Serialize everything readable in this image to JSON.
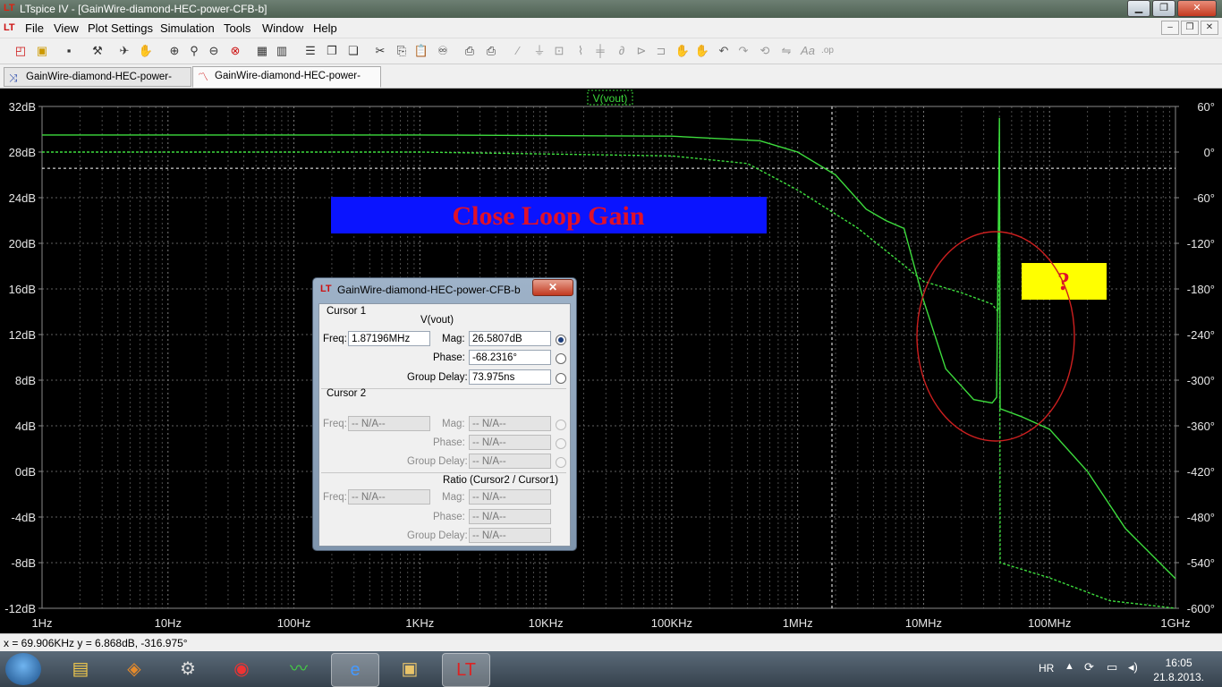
{
  "window": {
    "title": "LTspice IV - [GainWire-diamond-HEC-power-CFB-b]",
    "buttons": {
      "minimize": "▁",
      "maximize": "❐",
      "close": "✕"
    },
    "mdi_buttons": {
      "minimize": "–",
      "restore": "❐",
      "close": "✕"
    }
  },
  "menu": [
    "File",
    "View",
    "Plot Settings",
    "Simulation",
    "Tools",
    "Window",
    "Help"
  ],
  "tabs": [
    {
      "label": "GainWire-diamond-HEC-power-CFB-b",
      "icon": "schematic-icon",
      "active": false
    },
    {
      "label": "GainWire-diamond-HEC-power-CFB-b",
      "icon": "waveform-icon",
      "active": true
    }
  ],
  "plot": {
    "trace_label": "V(vout)",
    "annotation": "Close Loop Gain",
    "question": "?",
    "colors": {
      "trace": "#3ddc3d",
      "grid": "#8a8a8a",
      "annotation_bg": "#0a14ff",
      "annotation_text": "#e0102a",
      "question_bg": "#ffff00",
      "circle": "#cc1f1f",
      "axis_text": "#e6e6e6"
    },
    "x_labels": [
      "1Hz",
      "10Hz",
      "100Hz",
      "1KHz",
      "10KHz",
      "100KHz",
      "1MHz",
      "10MHz",
      "100MHz",
      "1GHz"
    ],
    "y_left_labels": [
      "32dB",
      "28dB",
      "24dB",
      "20dB",
      "16dB",
      "12dB",
      "8dB",
      "4dB",
      "0dB",
      "-4dB",
      "-8dB",
      "-12dB"
    ],
    "y_right_labels": [
      "60°",
      "0°",
      "-60°",
      "-120°",
      "-180°",
      "-240°",
      "-300°",
      "-360°",
      "-420°",
      "-480°",
      "-540°",
      "-600°"
    ]
  },
  "chart_data": {
    "type": "line",
    "title": "",
    "xlabel": "",
    "ylabel": "",
    "x_scale": "log",
    "xlim": [
      "1Hz",
      "1GHz"
    ],
    "ylim_left_db": [
      -12,
      32
    ],
    "ylim_right_deg": [
      -600,
      60
    ],
    "series": [
      {
        "name": "V(vout)",
        "axis": "magnitude dB",
        "points": [
          [
            1,
            29.5
          ],
          [
            1000,
            29.5
          ],
          [
            100000,
            29.4
          ],
          [
            500000,
            29.0
          ],
          [
            1000000,
            28.0
          ],
          [
            2000000,
            26.0
          ],
          [
            3500000,
            23.0
          ],
          [
            5000000,
            22.0
          ],
          [
            7000000,
            21.3
          ],
          [
            10000000,
            15.0
          ],
          [
            15000000,
            9.0
          ],
          [
            25000000,
            6.3
          ],
          [
            35000000,
            6.0
          ],
          [
            38000000,
            6.5
          ],
          [
            40000000,
            31.0
          ],
          [
            40500000,
            5.5
          ],
          [
            60000000,
            4.8
          ],
          [
            100000000,
            3.7
          ],
          [
            200000000,
            0.0
          ],
          [
            400000000,
            -5.0
          ],
          [
            1000000000,
            -9.4
          ]
        ]
      },
      {
        "name": "V(vout)",
        "axis": "phase deg",
        "points": [
          [
            1,
            0
          ],
          [
            1000,
            0
          ],
          [
            100000,
            -5
          ],
          [
            400000,
            -15
          ],
          [
            1000000,
            -50
          ],
          [
            3000000,
            -100
          ],
          [
            6000000,
            -140
          ],
          [
            10000000,
            -170
          ],
          [
            20000000,
            -185
          ],
          [
            35000000,
            -200
          ],
          [
            39000000,
            -210
          ],
          [
            40000000,
            30
          ],
          [
            40500000,
            -540
          ],
          [
            100000000,
            -560
          ],
          [
            300000000,
            -590
          ],
          [
            1000000000,
            -600
          ]
        ]
      }
    ]
  },
  "cursor_dialog": {
    "title": "GainWire-diamond-HEC-power-CFB-b",
    "cursor1": {
      "header": "Cursor 1",
      "signal": "V(vout)",
      "freq_label": "Freq:",
      "freq": "1.87196MHz",
      "mag_label": "Mag:",
      "mag": "26.5807dB",
      "phase_label": "Phase:",
      "phase": "-68.2316°",
      "gd_label": "Group Delay:",
      "gd": "73.975ns"
    },
    "cursor2": {
      "header": "Cursor 2",
      "freq_label": "Freq:",
      "freq": "-- N/A--",
      "mag_label": "Mag:",
      "mag": "-- N/A--",
      "phase_label": "Phase:",
      "phase": "-- N/A--",
      "gd_label": "Group Delay:",
      "gd": "-- N/A--"
    },
    "ratio": {
      "header": "Ratio (Cursor2 / Cursor1)",
      "freq_label": "Freq:",
      "freq": "-- N/A--",
      "mag_label": "Mag:",
      "mag": "-- N/A--",
      "phase_label": "Phase:",
      "phase": "-- N/A--",
      "gd_label": "Group Delay:",
      "gd": "-- N/A--"
    }
  },
  "status": "x = 69.906KHz   y = 6.868dB, -316.975°",
  "taskbar": {
    "lang": "HR",
    "time": "16:05",
    "date": "21.8.2013."
  }
}
